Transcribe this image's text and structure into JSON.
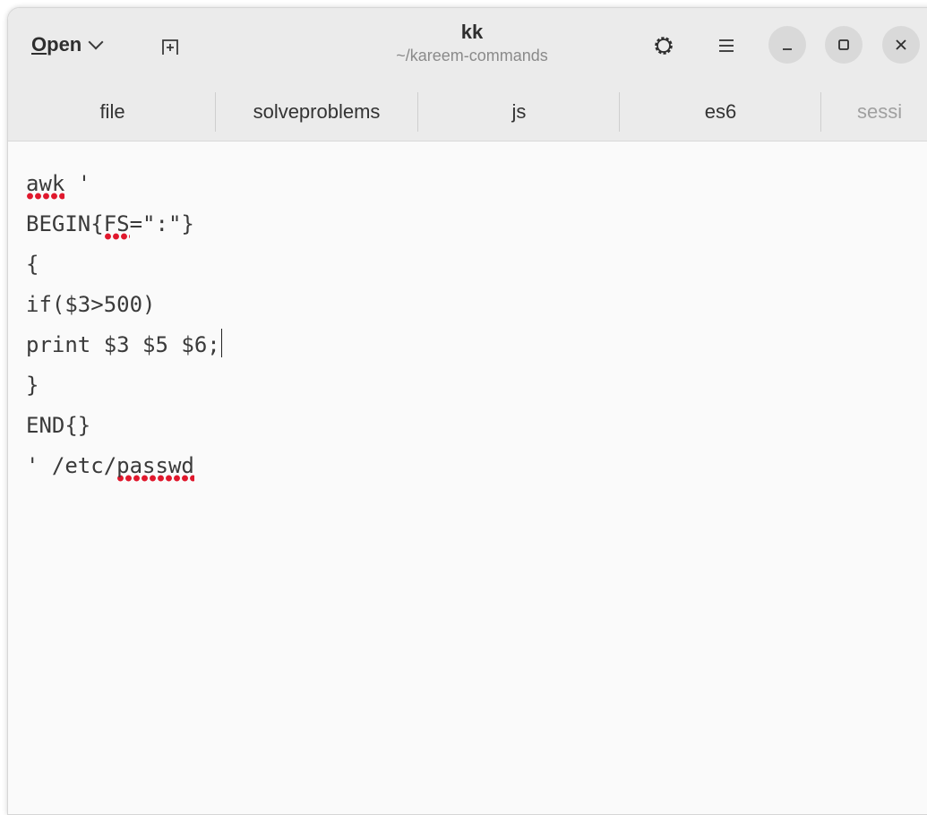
{
  "header": {
    "open_label_mnemonic": "O",
    "open_label_rest": "pen",
    "title": "kk",
    "subtitle": "~/kareem-commands"
  },
  "icons": {
    "new_tab": "new-tab-icon",
    "gear": "gear-icon",
    "menu": "hamburger-menu-icon",
    "minimize": "minimize-icon",
    "maximize": "maximize-icon",
    "close": "close-icon",
    "open_dropdown": "chevron-down-icon"
  },
  "tabs": [
    {
      "label": "file"
    },
    {
      "label": "solveproblems"
    },
    {
      "label": "js"
    },
    {
      "label": "es6"
    },
    {
      "label": "sessi"
    }
  ],
  "editor": {
    "lines": [
      {
        "before": "",
        "misspelled": "awk",
        "after": " '"
      },
      {
        "before": "BEGIN{",
        "misspelled": "FS",
        "after": "=\":\"}"
      },
      {
        "before": "{",
        "misspelled": "",
        "after": ""
      },
      {
        "before": "if($3>500)",
        "misspelled": "",
        "after": ""
      },
      {
        "before": "print $3 $5 $6;",
        "misspelled": "",
        "after": ""
      },
      {
        "before": "}",
        "misspelled": "",
        "after": ""
      },
      {
        "before": "END{}",
        "misspelled": "",
        "after": ""
      },
      {
        "before": "' /etc/",
        "misspelled": "passwd",
        "after": ""
      }
    ],
    "caret_line": 4
  },
  "colors": {
    "headerbar": "#ebebeb",
    "editor_bg": "#fafafa",
    "spell_underline": "#e0182d",
    "text": "#3a3a3a"
  }
}
